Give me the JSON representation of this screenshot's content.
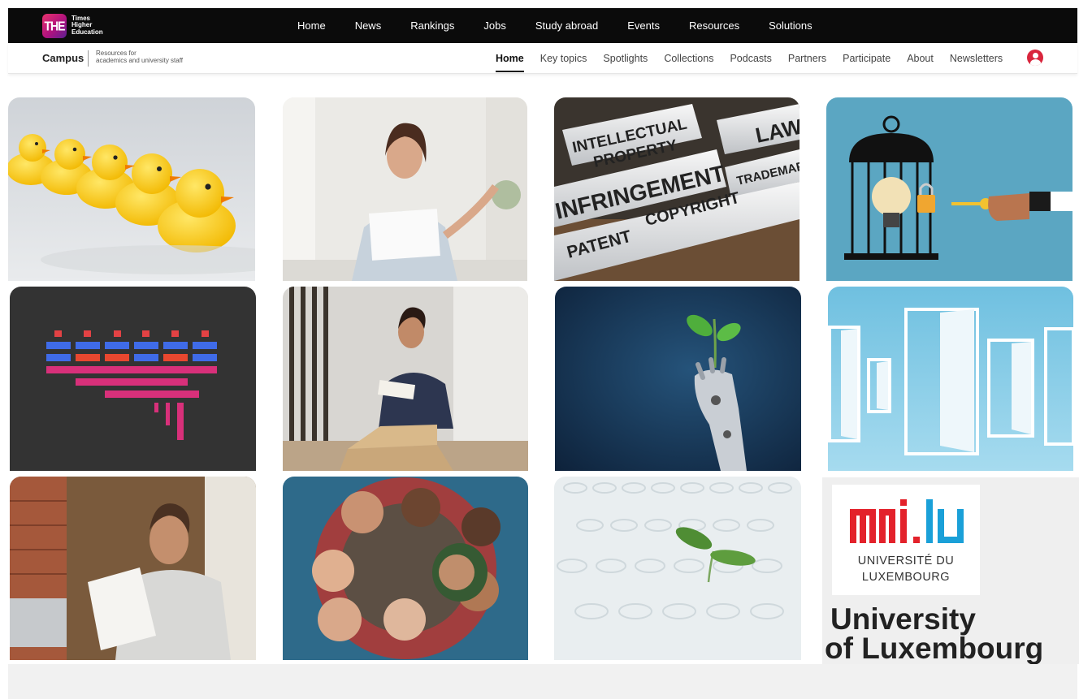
{
  "topbar": {
    "logo_badge": "THE",
    "logo_line1": "Times",
    "logo_line2": "Higher",
    "logo_line3": "Education",
    "nav": [
      "Home",
      "News",
      "Rankings",
      "Jobs",
      "Study abroad",
      "Events",
      "Resources",
      "Solutions"
    ]
  },
  "subbar": {
    "brand": "Campus",
    "tagline_line1": "Resources for",
    "tagline_line2": "academics and university staff",
    "nav": [
      "Home",
      "Key topics",
      "Spotlights",
      "Collections",
      "Podcasts",
      "Partners",
      "Participate",
      "About",
      "Newsletters"
    ],
    "active": "Home"
  },
  "tiles": {
    "ip_words": {
      "intellectual": "INTELLECTUAL",
      "property": "PROPERTY",
      "law": "LAW",
      "infringement": "INFRINGEMENT",
      "trademark": "TRADEMARK",
      "copyright": "COPYRIGHT",
      "patent": "PATENT"
    },
    "university": {
      "logo_text": "uni.lu",
      "line1": "UNIVERSITÉ DU",
      "line2": "LUXEMBOURG",
      "big1": "University",
      "big2": "of Luxembourg"
    }
  },
  "colors": {
    "topbar_bg": "#0b0b0b",
    "accent_red": "#d9263d",
    "uni_red": "#e3222b",
    "uni_blue": "#1aa0d8"
  }
}
